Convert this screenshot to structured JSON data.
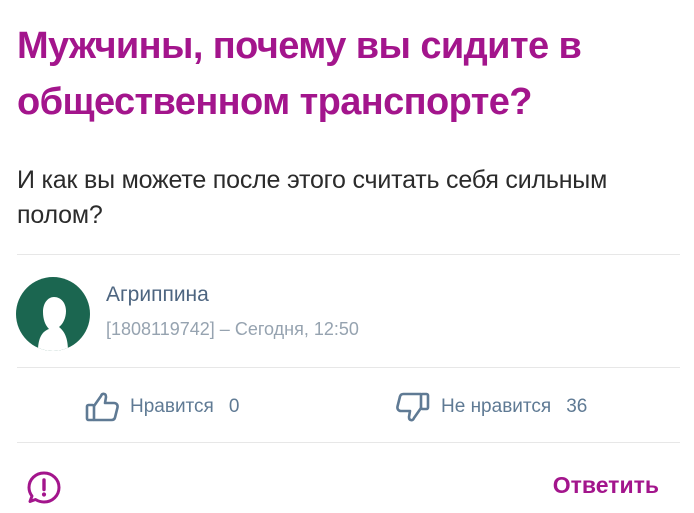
{
  "question": {
    "title": "Мужчины, почему вы сидите в общественном транспорте?",
    "body": "И как вы можете после этого считать себя сильным полом?"
  },
  "author": {
    "name": "Агриппина",
    "id": "[1808119742]",
    "separator": "–",
    "time": "Сегодня, 12:50",
    "avatar_color": "#1b6650"
  },
  "votes": {
    "like_label": "Нравится",
    "like_count": "0",
    "dislike_label": "Не нравится",
    "dislike_count": "36"
  },
  "actions": {
    "reply_label": "Ответить",
    "report_icon": "exclamation-circle-icon"
  },
  "colors": {
    "accent": "#a3158c",
    "link": "#5f7a94",
    "meta": "#96a3b0"
  }
}
